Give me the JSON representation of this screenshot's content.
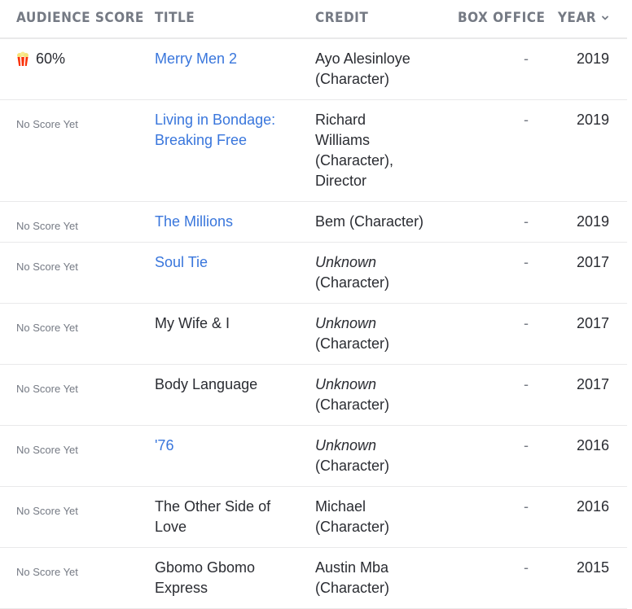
{
  "header": {
    "audience_score": "AUDIENCE SCORE",
    "title": "TITLE",
    "credit": "CREDIT",
    "box_office": "BOX OFFICE",
    "year": "YEAR"
  },
  "rows": [
    {
      "score": "60%",
      "title": "Merry Men 2",
      "title_link": true,
      "credit_name": "Ayo Alesinloye",
      "credit_name_italic": false,
      "credit_role": "(Character)",
      "box_office": "-",
      "year": "2019"
    },
    {
      "score": "No Score Yet",
      "title": "Living in Bondage: Breaking Free",
      "title_link": true,
      "credit_name": "Richard Williams",
      "credit_name_italic": false,
      "credit_role": "(Character), Director",
      "box_office": "-",
      "year": "2019"
    },
    {
      "score": "No Score Yet",
      "title": "The Millions",
      "title_link": true,
      "credit_name": "Bem",
      "credit_name_italic": false,
      "credit_role": "(Character)",
      "box_office": "-",
      "year": "2019"
    },
    {
      "score": "No Score Yet",
      "title": "Soul Tie",
      "title_link": true,
      "credit_name": "Unknown",
      "credit_name_italic": true,
      "credit_role": "(Character)",
      "box_office": "-",
      "year": "2017"
    },
    {
      "score": "No Score Yet",
      "title": "My Wife & I",
      "title_link": false,
      "credit_name": "Unknown",
      "credit_name_italic": true,
      "credit_role": "(Character)",
      "box_office": "-",
      "year": "2017"
    },
    {
      "score": "No Score Yet",
      "title": "Body Language",
      "title_link": false,
      "credit_name": "Unknown",
      "credit_name_italic": true,
      "credit_role": "(Character)",
      "box_office": "-",
      "year": "2017"
    },
    {
      "score": "No Score Yet",
      "title": "'76",
      "title_link": true,
      "credit_name": "Unknown",
      "credit_name_italic": true,
      "credit_role": "(Character)",
      "box_office": "-",
      "year": "2016"
    },
    {
      "score": "No Score Yet",
      "title": "The Other Side of Love",
      "title_link": false,
      "credit_name": "Michael",
      "credit_name_italic": false,
      "credit_role": "(Character)",
      "box_office": "-",
      "year": "2016"
    },
    {
      "score": "No Score Yet",
      "title": "Gbomo Gbomo Express",
      "title_link": false,
      "credit_name": "Austin Mba",
      "credit_name_italic": false,
      "credit_role": "(Character)",
      "box_office": "-",
      "year": "2015"
    }
  ],
  "colors": {
    "link": "#3976dc",
    "header_text": "#757a84",
    "body_text": "#2a2c32",
    "divider": "#e9e9ea"
  },
  "icons": {
    "popcorn": "popcorn-icon",
    "sort": "chevron-down-icon"
  }
}
